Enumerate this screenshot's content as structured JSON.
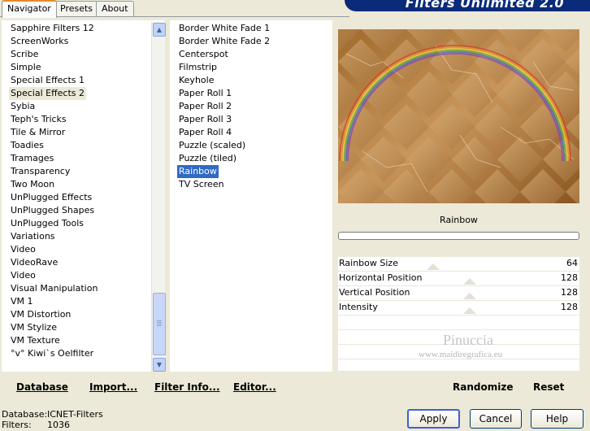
{
  "banner": {
    "title": "Filters Unlimited 2.0"
  },
  "tabs": [
    {
      "label": "Navigator"
    },
    {
      "label": "Presets"
    },
    {
      "label": "About"
    }
  ],
  "categories": [
    "Sapphire Filters 12",
    "ScreenWorks",
    "Scribe",
    "Simple",
    "Special Effects 1",
    "Special Effects 2",
    "Sybia",
    "Teph's Tricks",
    "Tile & Mirror",
    "Toadies",
    "Tramages",
    "Transparency",
    "Two Moon",
    "UnPlugged Effects",
    "UnPlugged Shapes",
    "UnPlugged Tools",
    "Variations",
    "Video",
    "VideoRave",
    "Video",
    "Visual Manipulation",
    "VM 1",
    "VM Distortion",
    "VM Stylize",
    "VM Texture",
    "°v° Kiwi`s Oelfilter"
  ],
  "selected_category": "Special Effects 2",
  "filters": [
    "Border White Fade 1",
    "Border White Fade 2",
    "Centerspot",
    "Filmstrip",
    "Keyhole",
    "Paper Roll 1",
    "Paper Roll 2",
    "Paper Roll 3",
    "Paper Roll 4",
    "Puzzle (scaled)",
    "Puzzle (tiled)",
    "Rainbow",
    "TV Screen"
  ],
  "selected_filter": "Rainbow",
  "filter_name": "Rainbow",
  "progress": 0,
  "params": [
    {
      "label": "Rainbow Size",
      "value": "64"
    },
    {
      "label": "Horizontal Position",
      "value": "128"
    },
    {
      "label": "Vertical Position",
      "value": "128"
    },
    {
      "label": "Intensity",
      "value": "128"
    }
  ],
  "watermark": {
    "name": "Pinuccia",
    "url": "www.maidiregrafica.eu"
  },
  "toolbar": {
    "database": "Database",
    "import": "Import...",
    "filter_info": "Filter Info...",
    "editor": "Editor...",
    "randomize": "Randomize",
    "reset": "Reset"
  },
  "status": {
    "database_label": "Database:",
    "database_value": "ICNET-Filters",
    "filters_label": "Filters:",
    "filters_value": "1036"
  },
  "buttons": {
    "apply": "Apply",
    "cancel": "Cancel",
    "help": "Help"
  }
}
